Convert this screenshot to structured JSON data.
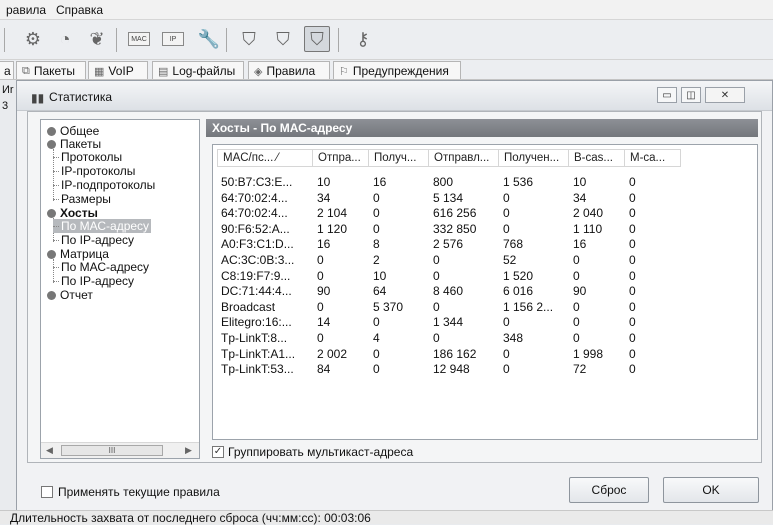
{
  "menubar": {
    "items": [
      "равила",
      "Справка"
    ]
  },
  "toolbar": {
    "icons": [
      "network-adapter-icon",
      "capture-icon",
      "plugin-icon",
      "mac-icon",
      "ip-icon",
      "tools-icon",
      "filter-icon",
      "mac-filter-icon",
      "active-filter-icon",
      "key-icon"
    ],
    "mac_label": "MAC",
    "ip_label": "IP"
  },
  "tabs": [
    {
      "label": "а"
    },
    {
      "label": "Пакеты",
      "icon": "packets-icon"
    },
    {
      "label": "VoIP",
      "icon": "voip-icon"
    },
    {
      "label": "Log-файлы",
      "icon": "log-icon"
    },
    {
      "label": "Правила",
      "icon": "rules-icon"
    },
    {
      "label": "Предупреждения",
      "icon": "alerts-icon"
    }
  ],
  "left_strip": {
    "line1": "Иr",
    "line2": "3"
  },
  "dialog": {
    "title": "Статистика",
    "title_icon": "bar-chart-icon",
    "controls": {
      "minimize": "▭",
      "restore": "◫",
      "close": "✕"
    },
    "tree": {
      "obshee": "Общее",
      "pakety": "Пакеты",
      "protokoly": "Протоколы",
      "ip_protokoly": "IP-протоколы",
      "ip_podprotokoly": "IP-подпротоколы",
      "razmery": "Размеры",
      "hosty": "Хосты",
      "po_mac": "По МАС-адресу",
      "po_ip": "По IP-адресу",
      "matrica": "Матрица",
      "m_po_mac": "По МАС-адресу",
      "m_po_ip": "По IP-адресу",
      "otchet": "Отчет",
      "scroll_thumb": "III"
    },
    "panel_title": "Хосты - По МАС-адресу",
    "table": {
      "columns": [
        "MAC/пс... ⁄",
        "Отпра...",
        "Получ...",
        "Отправл...",
        "Получен...",
        "B-cas...",
        "M-ca..."
      ],
      "rows": [
        [
          "50:B7:C3:E...",
          "10",
          "16",
          "800",
          "1 536",
          "10",
          "0"
        ],
        [
          "64:70:02:4...",
          "34",
          "0",
          "5 134",
          "0",
          "34",
          "0"
        ],
        [
          "64:70:02:4...",
          "2 104",
          "0",
          "616 256",
          "0",
          "2 040",
          "0"
        ],
        [
          "90:F6:52:A...",
          "1 120",
          "0",
          "332 850",
          "0",
          "1 110",
          "0"
        ],
        [
          "A0:F3:C1:D...",
          "16",
          "8",
          "2 576",
          "768",
          "16",
          "0"
        ],
        [
          "AC:3C:0B:3...",
          "0",
          "2",
          "0",
          "52",
          "0",
          "0"
        ],
        [
          "C8:19:F7:9...",
          "0",
          "10",
          "0",
          "1 520",
          "0",
          "0"
        ],
        [
          "DC:71:44:4...",
          "90",
          "64",
          "8 460",
          "6 016",
          "90",
          "0"
        ],
        [
          "Broadcast",
          "0",
          "5 370",
          "0",
          "1 156 2...",
          "0",
          "0"
        ],
        [
          "Elitegro:16:...",
          "14",
          "0",
          "1 344",
          "0",
          "0",
          "0"
        ],
        [
          "Tp-LinkT:8...",
          "0",
          "4",
          "0",
          "348",
          "0",
          "0"
        ],
        [
          "Tp-LinkT:A1...",
          "2 002",
          "0",
          "186 162",
          "0",
          "1 998",
          "0"
        ],
        [
          "Tp-LinkT:53...",
          "84",
          "0",
          "12 948",
          "0",
          "72",
          "0"
        ]
      ]
    },
    "group_multicast": "Группировать мультикаст-адреса",
    "apply_rules": "Применять текущие правила",
    "reset_button": "Сброс",
    "ok_button": "OK"
  },
  "status": "Длительность захвата от последнего сброса (чч:мм:сс): 00:03:06"
}
